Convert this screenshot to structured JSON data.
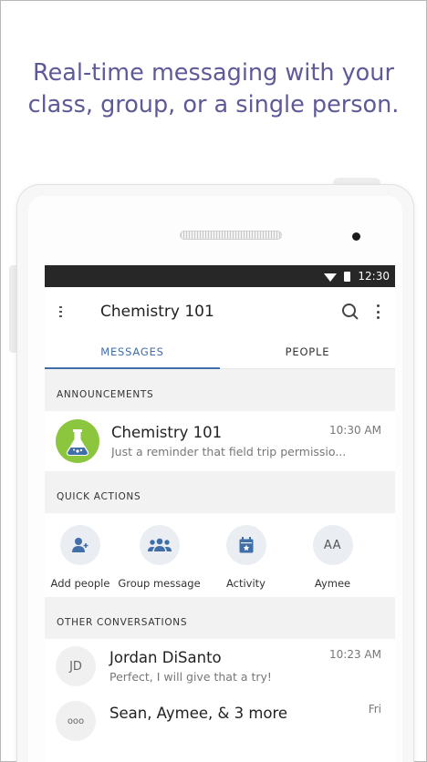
{
  "headline": {
    "line1": "Real-time messaging with your",
    "line2": "class, group, or a single person."
  },
  "statusbar": {
    "time": "12:30"
  },
  "toolbar": {
    "title": "Chemistry 101"
  },
  "tabs": [
    {
      "label": "MESSAGES",
      "active": true
    },
    {
      "label": "PEOPLE",
      "active": false
    }
  ],
  "announcements": {
    "header": "ANNOUNCEMENTS",
    "item": {
      "name": "Chemistry 101",
      "preview": "Just a reminder that field trip permissio...",
      "time": "10:30 AM"
    }
  },
  "quick_actions": {
    "header": "QUICK ACTIONS",
    "items": [
      {
        "label": "Add people",
        "icon": "add-person-icon"
      },
      {
        "label": "Group message",
        "icon": "group-icon"
      },
      {
        "label": "Activity",
        "icon": "calendar-icon"
      },
      {
        "label": "Aymee",
        "initials": "AA"
      }
    ]
  },
  "conversations": {
    "header": "OTHER CONVERSATIONS",
    "items": [
      {
        "initials": "JD",
        "name": "Jordan DiSanto",
        "preview": "Perfect, I will give that a try!",
        "time": "10:23 AM"
      },
      {
        "initials": "ooo",
        "name": "Sean, Aymee, & 3 more",
        "preview": "",
        "time": "Fri"
      }
    ]
  },
  "colors": {
    "accent": "#3f6ea9",
    "headline": "#5e5a9a",
    "avatar_green": "#8cc63f",
    "icon_blue": "#3f6ea9"
  }
}
